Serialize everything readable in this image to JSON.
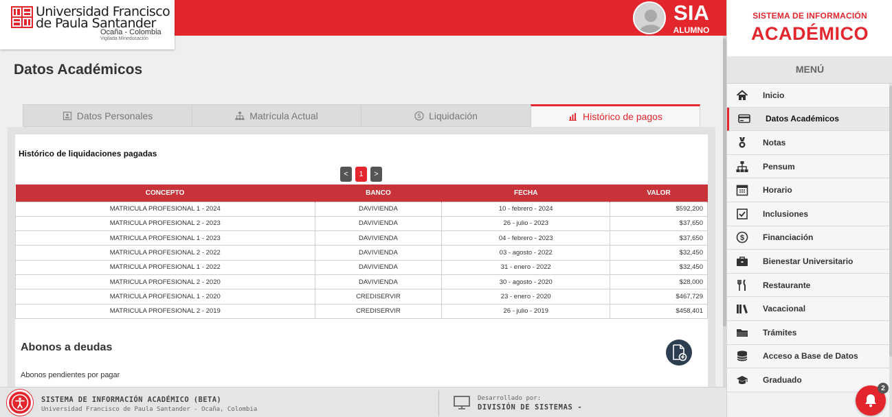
{
  "header": {
    "logo_line1": "Universidad Francisco",
    "logo_line2": "de Paula Santander",
    "logo_city": "Ocaña - Colombia",
    "logo_vigilada": "Vigilada Mineducación",
    "sia_title": "SIA",
    "sia_role": "ALUMNO"
  },
  "page": {
    "title": "Datos Académicos",
    "tabs": [
      {
        "label": "Datos Personales",
        "icon": "id-card-icon",
        "active": false
      },
      {
        "label": "Matrícula Actual",
        "icon": "sitemap-icon",
        "active": false
      },
      {
        "label": "Liquidación",
        "icon": "dollar-circle-icon",
        "active": false
      },
      {
        "label": "Histórico de pagos",
        "icon": "bar-chart-icon",
        "active": true
      }
    ]
  },
  "historico": {
    "title": "Histórico de liquidaciones pagadas",
    "pager": {
      "prev": "<",
      "current": "1",
      "next": ">"
    },
    "columns": [
      "CONCEPTO",
      "BANCO",
      "FECHA",
      "VALOR"
    ],
    "rows": [
      {
        "concepto": "MATRICULA PROFESIONAL 1 - 2024",
        "banco": "DAVIVIENDA",
        "fecha": "10 - febrero - 2024",
        "valor": "$592,200"
      },
      {
        "concepto": "MATRICULA PROFESIONAL 2 - 2023",
        "banco": "DAVIVIENDA",
        "fecha": "26 - julio - 2023",
        "valor": "$37,650"
      },
      {
        "concepto": "MATRICULA PROFESIONAL 1 - 2023",
        "banco": "DAVIVIENDA",
        "fecha": "04 - febrero - 2023",
        "valor": "$37,650"
      },
      {
        "concepto": "MATRICULA PROFESIONAL 2 - 2022",
        "banco": "DAVIVIENDA",
        "fecha": "03 - agosto - 2022",
        "valor": "$32,450"
      },
      {
        "concepto": "MATRICULA PROFESIONAL 1 - 2022",
        "banco": "DAVIVIENDA",
        "fecha": "31 - enero - 2022",
        "valor": "$32,450"
      },
      {
        "concepto": "MATRICULA PROFESIONAL 2 - 2020",
        "banco": "DAVIVIENDA",
        "fecha": "30 - agosto - 2020",
        "valor": "$28,000"
      },
      {
        "concepto": "MATRICULA PROFESIONAL 1 - 2020",
        "banco": "CREDISERVIR",
        "fecha": "23 - enero - 2020",
        "valor": "$467,729"
      },
      {
        "concepto": "MATRICULA PROFESIONAL 2 - 2019",
        "banco": "CREDISERVIR",
        "fecha": "26 - julio - 2019",
        "valor": "$458,401"
      }
    ]
  },
  "abonos": {
    "title": "Abonos a deudas",
    "subtitle": "Abonos pendientes por pagar",
    "icon": "document-add-icon"
  },
  "footer": {
    "line1": "SISTEMA DE INFORMACIÓN ACADÉMICO (BETA)",
    "line2": "Universidad Francisco de Paula Santander - Ocaña, Colombia",
    "dev_label": "Desarrollado por:",
    "dev_name": "DIVISIÓN DE SISTEMAS -"
  },
  "sidebar": {
    "head_line1": "SISTEMA DE INFORMACIÓN",
    "head_line2": "ACADÉMICO",
    "menu_title": "MENÚ",
    "items": [
      {
        "label": "Inicio",
        "icon": "home-icon",
        "active": false
      },
      {
        "label": "Datos Académicos",
        "icon": "credit-card-icon",
        "active": true
      },
      {
        "label": "Notas",
        "icon": "medal-icon",
        "active": false
      },
      {
        "label": "Pensum",
        "icon": "sitemap-icon",
        "active": false
      },
      {
        "label": "Horario",
        "icon": "calendar-icon",
        "active": false
      },
      {
        "label": "Inclusiones",
        "icon": "checkbox-icon",
        "active": false
      },
      {
        "label": "Financiación",
        "icon": "dollar-circle-icon",
        "active": false
      },
      {
        "label": "Bienestar Universitario",
        "icon": "briefcase-icon",
        "active": false
      },
      {
        "label": "Restaurante",
        "icon": "utensils-icon",
        "active": false
      },
      {
        "label": "Vacacional",
        "icon": "books-icon",
        "active": false
      },
      {
        "label": "Trámites",
        "icon": "folder-icon",
        "active": false
      },
      {
        "label": "Acceso a Base de Datos",
        "icon": "database-icon",
        "active": false
      },
      {
        "label": "Graduado",
        "icon": "graduation-cap-icon",
        "active": false
      }
    ]
  },
  "notifications": {
    "count": "2"
  },
  "colors": {
    "brand_red": "#e3262e",
    "table_header": "#c8333a",
    "dark_button": "#2d3e50"
  }
}
